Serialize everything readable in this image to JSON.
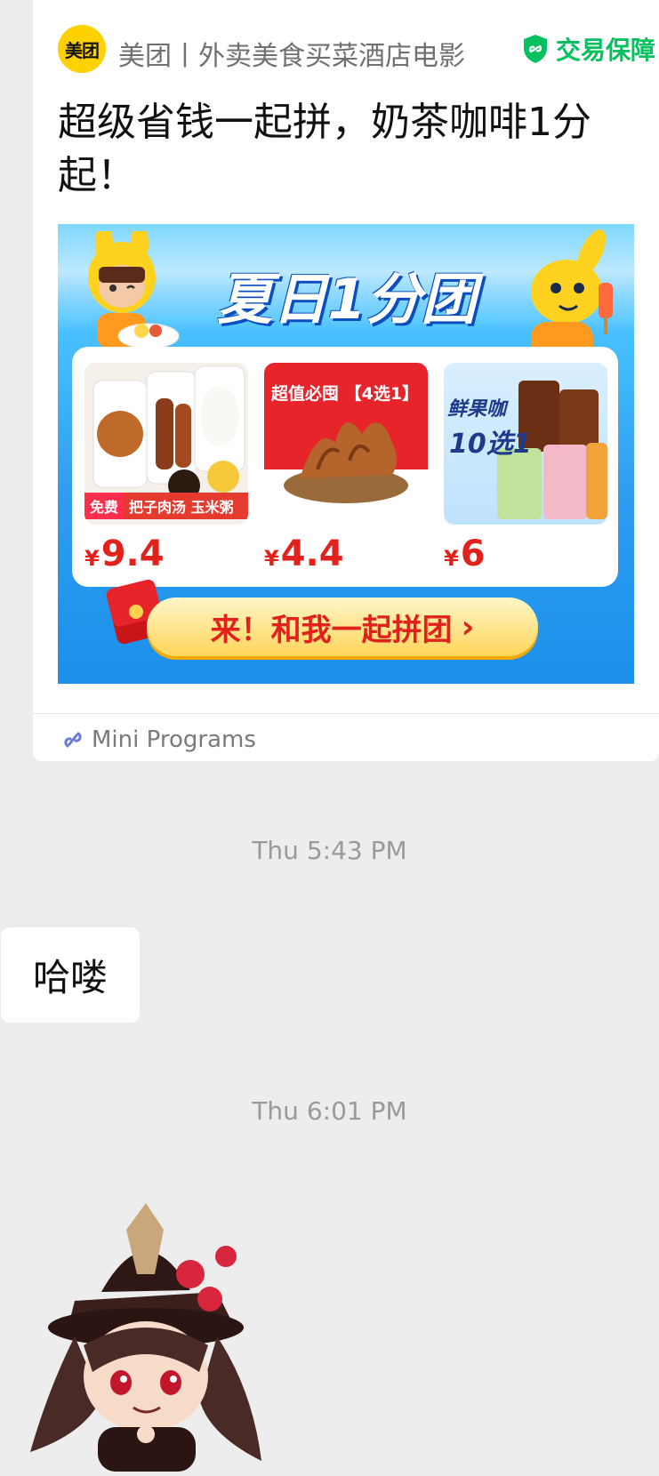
{
  "card": {
    "brand_logo_text": "美团",
    "brand_name": "美团丨外卖美食买菜酒店电影",
    "badge_icon": "shield-check-icon",
    "badge_label": "交易保障",
    "title": "超级省钱一起拼，奶茶咖啡1分起！",
    "promo": {
      "headline": "夏日1分团",
      "products": [
        {
          "tag": "免费",
          "label": "把子肉汤 玉米粥",
          "currency": "¥",
          "price": "9.4"
        },
        {
          "banner": "超值必囤 【4选1】",
          "currency": "¥",
          "price": "4.4"
        },
        {
          "title": "鲜果咖",
          "subtitle": "10选1",
          "currency": "¥",
          "price": "6"
        }
      ],
      "cta_label": "来！和我一起拼团",
      "cta_arrow": "›"
    },
    "footer_icon": "mini-program-icon",
    "footer_label": "Mini Programs"
  },
  "messages": {
    "timestamp_1": "Thu 5:43 PM",
    "bubble_text": "哈喽",
    "timestamp_2": "Thu 6:01 PM",
    "sticker": "anime-girl-sticker"
  },
  "colors": {
    "background": "#ededed",
    "accent_green": "#07c160",
    "brand_yellow": "#ffd100",
    "price_red": "#e0211c"
  }
}
